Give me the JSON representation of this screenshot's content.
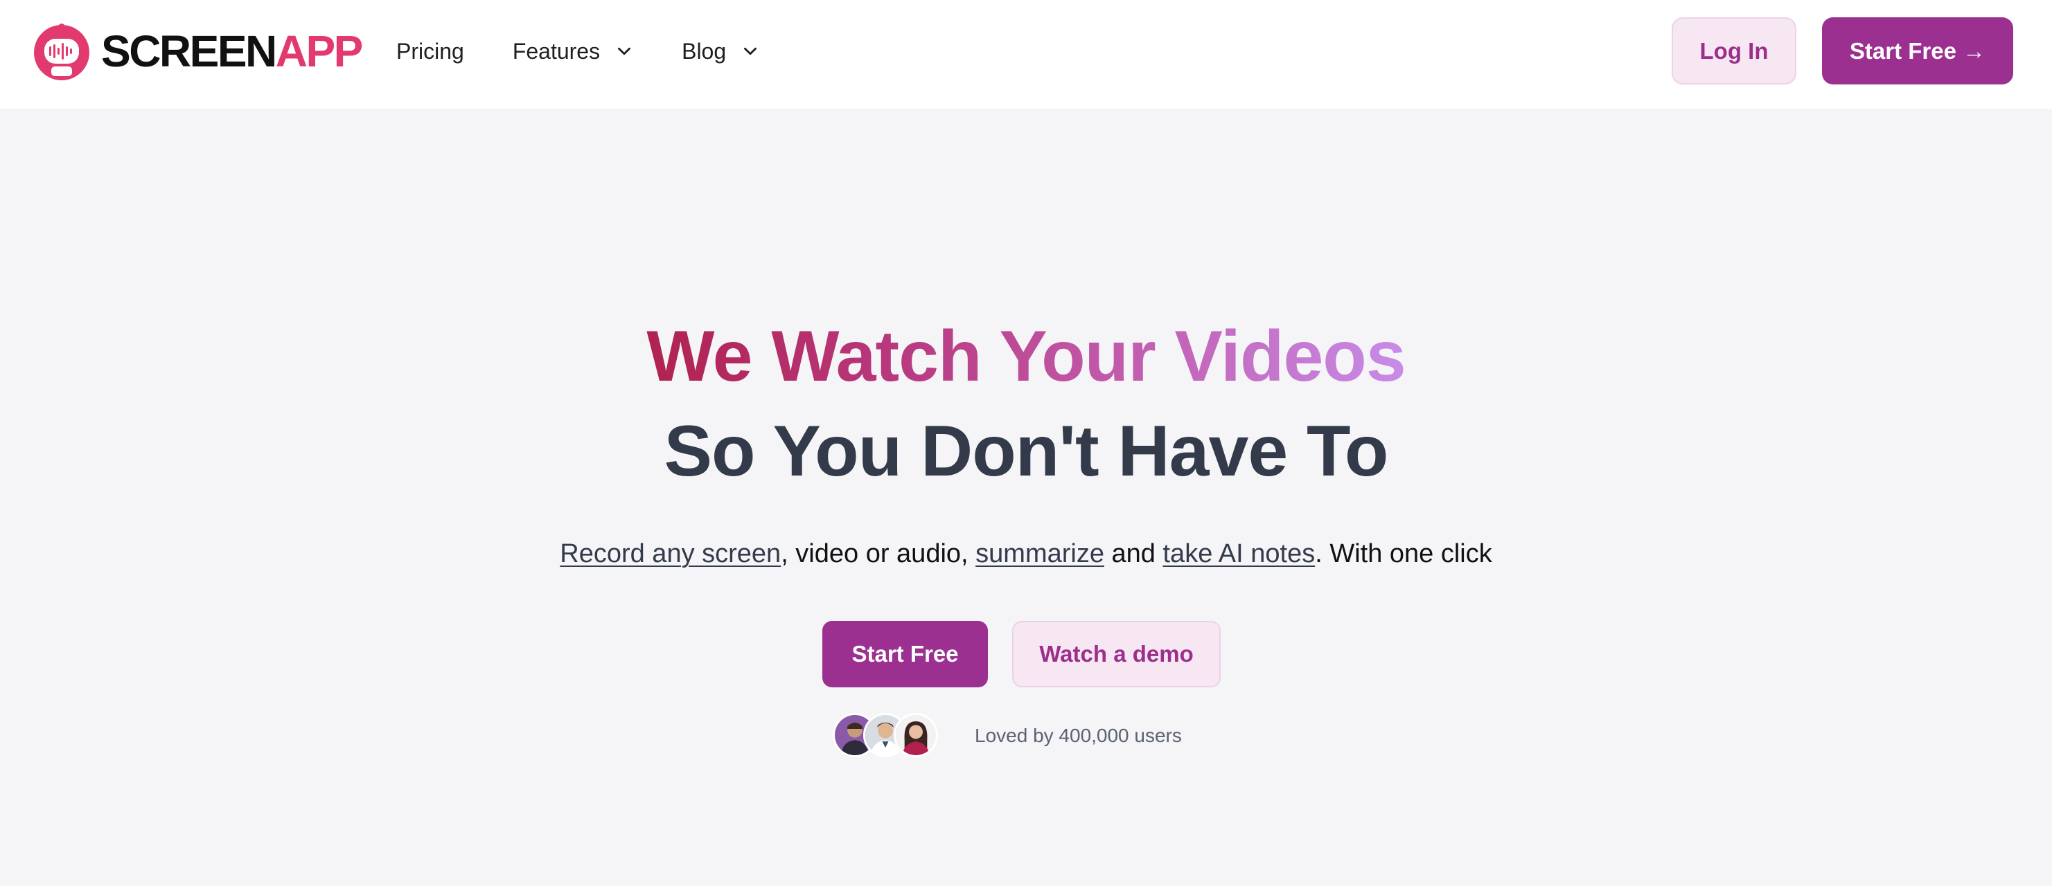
{
  "brand": {
    "name_part1": "SCREEN",
    "name_part2": "APP",
    "logo_icon": "robot-waveform-icon",
    "colors": {
      "brand_pink": "#e23a6e",
      "primary_purple": "#9b3090",
      "secondary_bg": "#f6e7f3"
    }
  },
  "nav": {
    "items": [
      {
        "label": "Pricing",
        "has_dropdown": false
      },
      {
        "label": "Features",
        "has_dropdown": true
      },
      {
        "label": "Blog",
        "has_dropdown": true
      }
    ]
  },
  "header_actions": {
    "login_label": "Log In",
    "start_free_label": "Start Free →"
  },
  "hero": {
    "headline_line1": "We Watch Your Videos",
    "headline_line2": "So You Don't Have To",
    "subtitle": {
      "link1": "Record any screen",
      "text1": ", video or audio, ",
      "link2": "summarize",
      "text2": " and ",
      "link3": "take AI notes",
      "text3": ". With one click"
    },
    "primary_cta": "Start Free",
    "secondary_cta": "Watch a demo",
    "social_proof": "Loved by 400,000 users",
    "avatar_count": 3
  }
}
